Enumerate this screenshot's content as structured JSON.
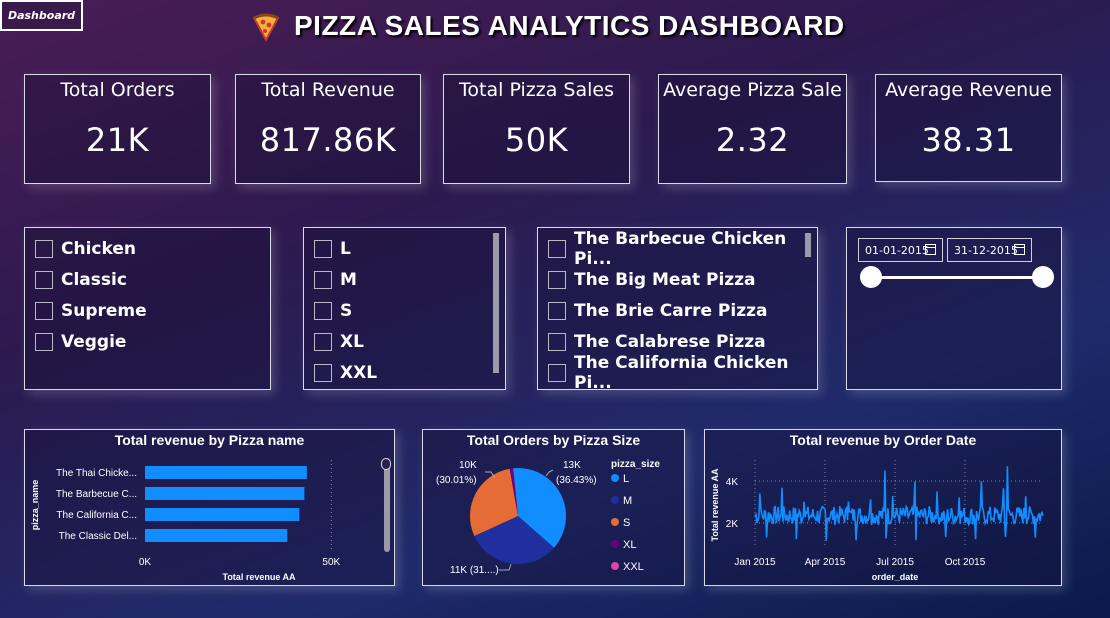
{
  "tab": {
    "label": "Dashboard"
  },
  "title": "PIZZA SALES ANALYTICS DASHBOARD",
  "kpis": [
    {
      "label": "Total Orders",
      "value": "21K"
    },
    {
      "label": "Total Revenue",
      "value": "817.86K"
    },
    {
      "label": "Total Pizza Sales",
      "value": "50K"
    },
    {
      "label": "Average Pizza Sale",
      "value": "2.32"
    },
    {
      "label": "Average Revenue",
      "value": "38.31"
    }
  ],
  "category_slicer": [
    "Chicken",
    "Classic",
    "Supreme",
    "Veggie"
  ],
  "size_slicer": [
    "L",
    "M",
    "S",
    "XL",
    "XXL"
  ],
  "name_slicer": [
    "The Barbecue Chicken Pi...",
    "The Big Meat Pizza",
    "The Brie Carre Pizza",
    "The Calabrese Pizza",
    "The California Chicken Pi..."
  ],
  "date_slicer": {
    "start": "01-01-2015",
    "end": "31-12-2015"
  },
  "colors": {
    "accent": "#118dff",
    "navy": "#1f2f9e",
    "orange": "#e66c37",
    "purple": "#6b007b",
    "pink": "#e044a7"
  },
  "chart_data": [
    {
      "type": "bar",
      "title": "Total revenue by Pizza name",
      "xlabel": "Total revenue AA",
      "ylabel": "pizza_name",
      "categories": [
        "The Thai Chicke...",
        "The Barbecue C...",
        "The California C...",
        "The Classic Del..."
      ],
      "values": [
        43434,
        42768,
        41410,
        38180
      ],
      "xlim": [
        0,
        60000
      ],
      "xticks": [
        "0K",
        "50K"
      ]
    },
    {
      "type": "pie",
      "title": "Total Orders by Pizza Size",
      "legend_title": "pizza_size",
      "labels": [
        "L",
        "M",
        "S",
        "XL",
        "XXL"
      ],
      "values": [
        18526,
        15385,
        14137,
        544,
        28
      ],
      "data_labels": [
        {
          "value": "13K",
          "pct": "(36.43%)"
        },
        {
          "value": "11K (31....)",
          "pct": ""
        },
        {
          "value": "10K",
          "pct": "(30.01%)"
        }
      ],
      "colors": [
        "#118dff",
        "#1f2f9e",
        "#e66c37",
        "#6b007b",
        "#e044a7"
      ]
    },
    {
      "type": "line",
      "title": "Total revenue by Order Date",
      "xlabel": "order_date",
      "ylabel": "Total revenue AA",
      "xticks": [
        "Jan 2015",
        "Apr 2015",
        "Jul 2015",
        "Oct 2015"
      ],
      "yticks": [
        "2K",
        "4K"
      ],
      "ylim": [
        800,
        5000
      ]
    }
  ]
}
